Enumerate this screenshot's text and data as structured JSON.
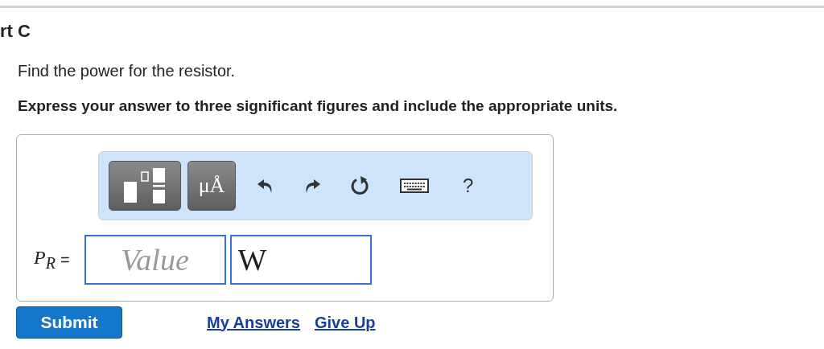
{
  "part_title": "rt C",
  "prompt": "Find the power for the resistor.",
  "instruction": "Express your answer to three significant figures and include the appropriate units.",
  "toolbar": {
    "units_button": "μÅ",
    "help": "?"
  },
  "answer": {
    "symbol": "P$_{R}$",
    "equals": "=",
    "value": {
      "placeholder": "Value"
    },
    "unit": {
      "value": "W"
    }
  },
  "submit": "Submit",
  "links": [
    "My Answers",
    "Give Up"
  ]
}
